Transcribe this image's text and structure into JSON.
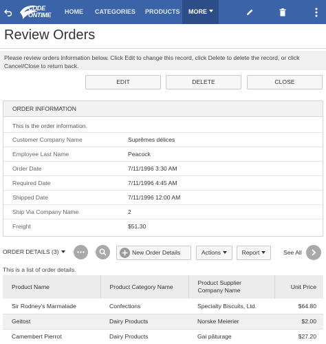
{
  "topbar": {
    "logo_line1": "CODE",
    "logo_line2": "ONTIME",
    "nav": [
      "HOME",
      "CATEGORIES",
      "PRODUCTS"
    ],
    "more_label": "MORE",
    "icons": [
      "undo-icon",
      "pencil-icon",
      "trash-icon",
      "more-vertical-icon"
    ],
    "bar_color": "#3b64a8",
    "more_color": "#2d4d86"
  },
  "page": {
    "title": "Review Orders",
    "description": "Please review orders information below. Click Edit to change this record, click Delete to delete the record, or click Cancel/Close to return back."
  },
  "actions": {
    "edit": "EDIT",
    "delete": "DELETE",
    "close": "CLOSE"
  },
  "order_info": {
    "header": "ORDER INFORMATION",
    "info_text": "This is the order information.",
    "fields": [
      {
        "label": "Customer Company Name",
        "value": "Suprêmes délices"
      },
      {
        "label": "Employee Last Name",
        "value": "Peacock"
      },
      {
        "label": "Order Date",
        "value": "7/11/1996 3:30 AM"
      },
      {
        "label": "Required Date",
        "value": "7/11/1996 4:45 AM"
      },
      {
        "label": "Shipped Date",
        "value": "7/11/1996 12:00 AM"
      },
      {
        "label": "Ship Via Company Name",
        "value": "2"
      },
      {
        "label": "Freight",
        "value": "$51.30"
      }
    ]
  },
  "order_details": {
    "title": "ORDER DETAILS (3)",
    "new_button": "New Order Details",
    "actions_button": "Actions",
    "report_button": "Report",
    "see_all": "See All",
    "info_text": "This is a list of order details.",
    "columns": [
      "Product Name",
      "Product Category Name",
      "Product Supplier Company Name",
      "Unit Price"
    ],
    "rows": [
      [
        "Sir Rodney's Marmalade",
        "Confections",
        "Specialty Biscuits, Ltd.",
        "$64.80"
      ],
      [
        "Geitost",
        "Dairy Products",
        "Norske Meierier",
        "$2.00"
      ],
      [
        "Camembert Pierrot",
        "Dairy Products",
        "Gai pâturage",
        "$27.20"
      ]
    ]
  }
}
